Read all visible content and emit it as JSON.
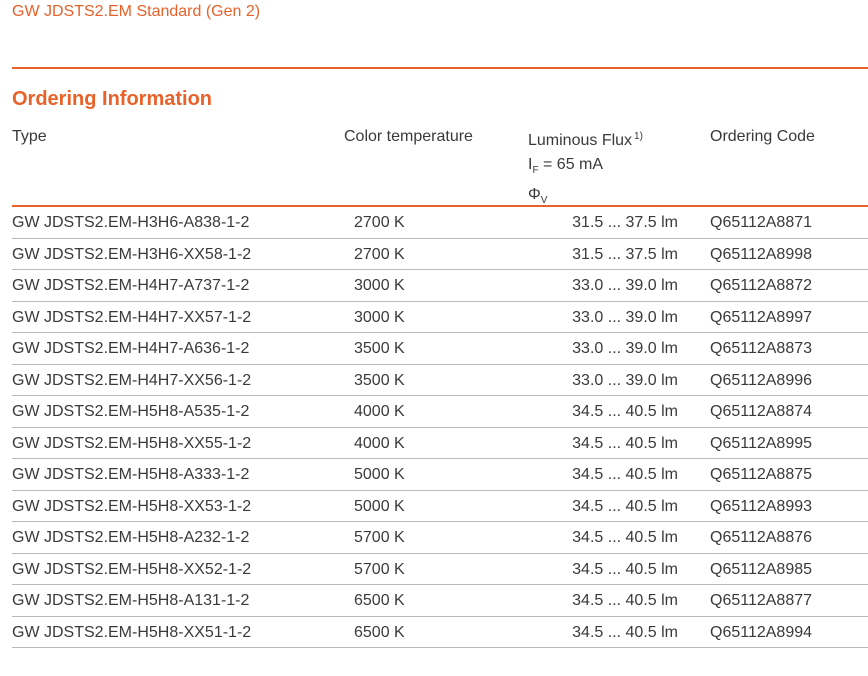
{
  "doc_title": "GW JDSTS2.EM Standard (Gen 2)",
  "section_title": "Ordering Information",
  "header": {
    "type": "Type",
    "color_temperature": "Color temperature",
    "luminous_flux": "Luminous Flux",
    "luminous_flux_note": "1)",
    "if_symbol": "I",
    "if_sub": "F",
    "if_value": " = 65 mA",
    "phi_symbol": "Φ",
    "phi_sub": "V",
    "ordering_code": "Ordering Code"
  },
  "rows": [
    {
      "type": "GW JDSTS2.EM-H3H6-A838-1-2",
      "color": "2700 K",
      "flux": "31.5 ... 37.5 lm",
      "code": "Q65112A8871"
    },
    {
      "type": "GW JDSTS2.EM-H3H6-XX58-1-2",
      "color": "2700 K",
      "flux": "31.5 ... 37.5 lm",
      "code": "Q65112A8998"
    },
    {
      "type": "GW JDSTS2.EM-H4H7-A737-1-2",
      "color": "3000 K",
      "flux": "33.0 ... 39.0 lm",
      "code": "Q65112A8872"
    },
    {
      "type": "GW JDSTS2.EM-H4H7-XX57-1-2",
      "color": "3000 K",
      "flux": "33.0 ... 39.0 lm",
      "code": "Q65112A8997"
    },
    {
      "type": "GW JDSTS2.EM-H4H7-A636-1-2",
      "color": "3500 K",
      "flux": "33.0 ... 39.0 lm",
      "code": "Q65112A8873"
    },
    {
      "type": "GW JDSTS2.EM-H4H7-XX56-1-2",
      "color": "3500 K",
      "flux": "33.0 ... 39.0 lm",
      "code": "Q65112A8996"
    },
    {
      "type": "GW JDSTS2.EM-H5H8-A535-1-2",
      "color": "4000 K",
      "flux": "34.5 ... 40.5 lm",
      "code": "Q65112A8874"
    },
    {
      "type": "GW JDSTS2.EM-H5H8-XX55-1-2",
      "color": "4000 K",
      "flux": "34.5 ... 40.5 lm",
      "code": "Q65112A8995"
    },
    {
      "type": "GW JDSTS2.EM-H5H8-A333-1-2",
      "color": "5000 K",
      "flux": "34.5 ... 40.5 lm",
      "code": "Q65112A8875"
    },
    {
      "type": "GW JDSTS2.EM-H5H8-XX53-1-2",
      "color": "5000 K",
      "flux": "34.5 ... 40.5 lm",
      "code": "Q65112A8993"
    },
    {
      "type": "GW JDSTS2.EM-H5H8-A232-1-2",
      "color": "5700 K",
      "flux": "34.5 ... 40.5 lm",
      "code": "Q65112A8876"
    },
    {
      "type": "GW JDSTS2.EM-H5H8-XX52-1-2",
      "color": "5700 K",
      "flux": "34.5 ... 40.5 lm",
      "code": "Q65112A8985"
    },
    {
      "type": "GW JDSTS2.EM-H5H8-A131-1-2",
      "color": "6500 K",
      "flux": "34.5 ... 40.5 lm",
      "code": "Q65112A8877"
    },
    {
      "type": "GW JDSTS2.EM-H5H8-XX51-1-2",
      "color": "6500 K",
      "flux": "34.5 ... 40.5 lm",
      "code": "Q65112A8994"
    }
  ],
  "colors": {
    "accent": "#e8622a",
    "text": "#3a3a3a",
    "row_rule": "#b8b8b8"
  }
}
